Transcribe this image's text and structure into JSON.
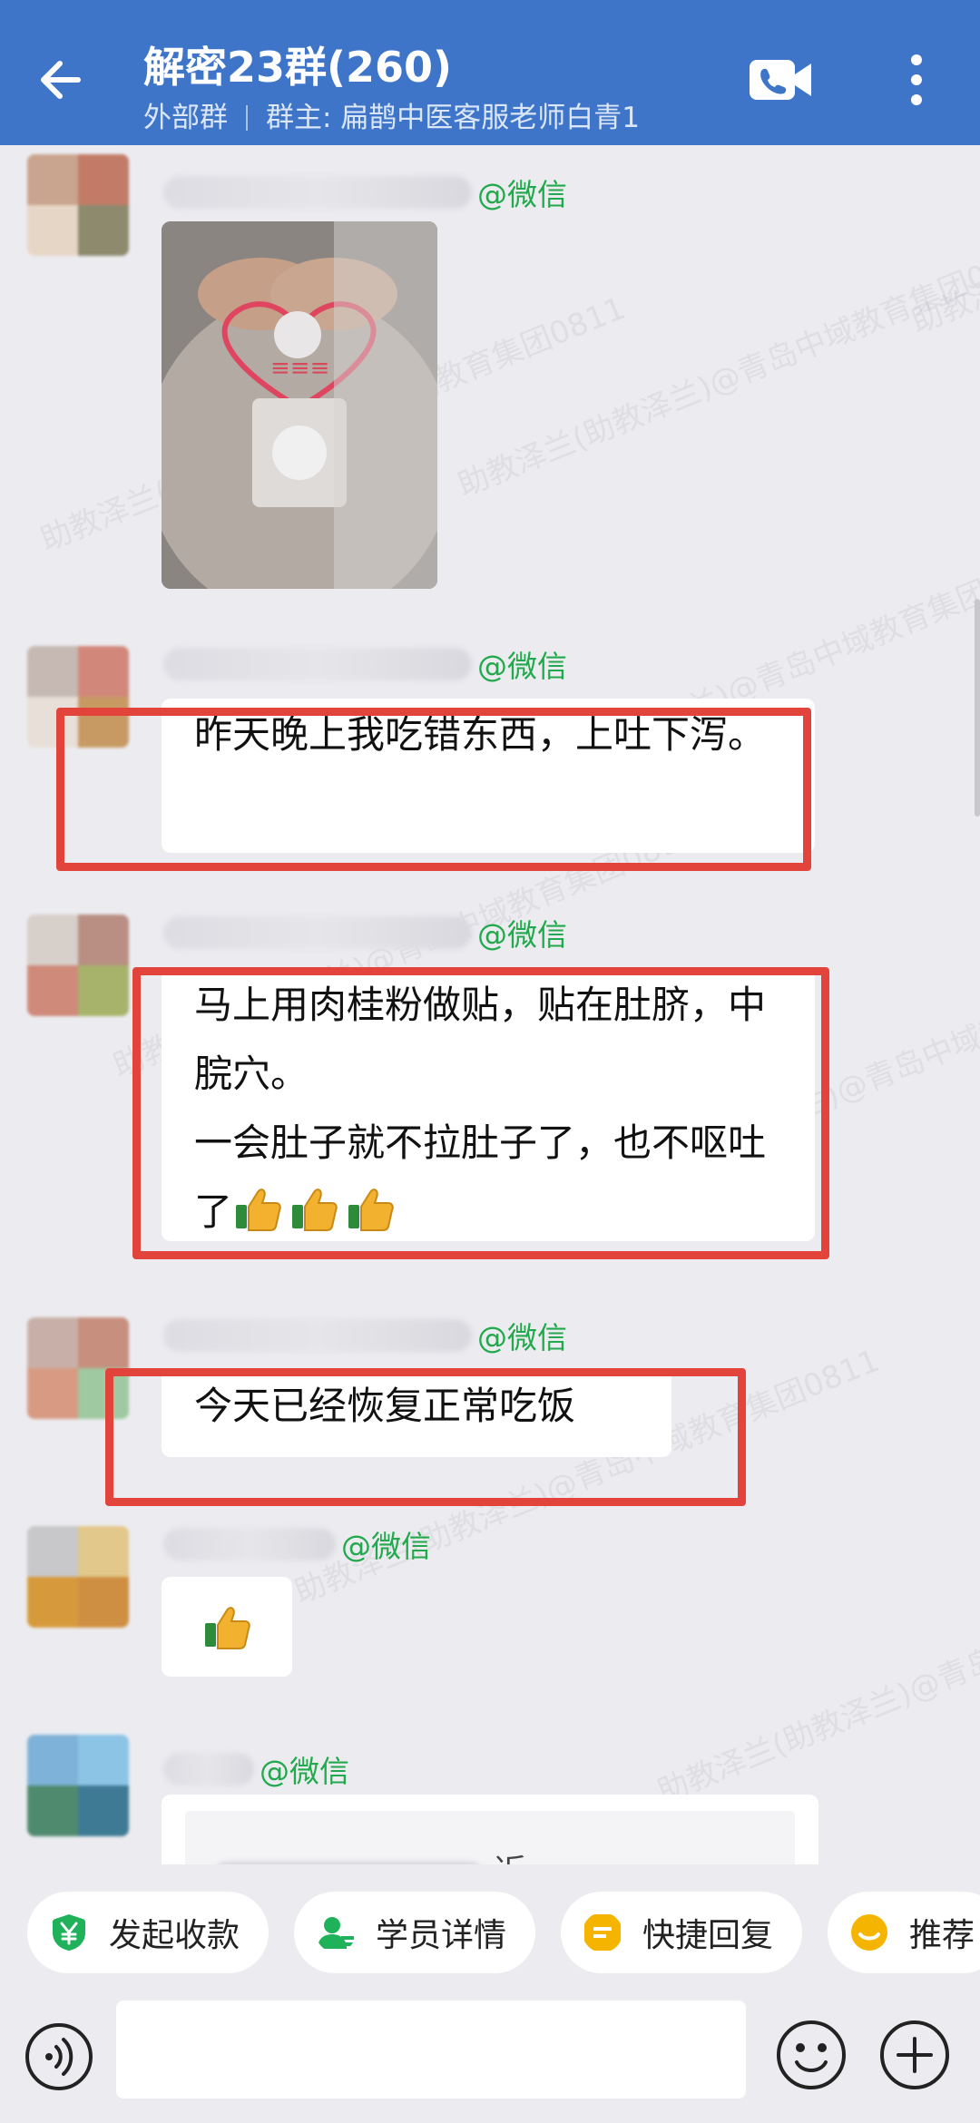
{
  "header": {
    "title": "解密23群(260)",
    "group_type": "外部群",
    "owner": "群主: 扁鹊中医客服老师白青1"
  },
  "watermark": {
    "text": "助教泽兰(助教泽兰)@青岛中域教育集团0811"
  },
  "messages": [
    {
      "tag": "@微信",
      "type": "image"
    },
    {
      "tag": "@微信",
      "text": "昨天晚上我吃错东西，上吐下泻。"
    },
    {
      "tag": "@微信",
      "text_line1": "马上用肉桂粉做贴，贴在肚脐，中脘穴。",
      "text_line2": "一会肚子就不拉肚子了，也不呕吐了"
    },
    {
      "tag": "@微信",
      "text": "今天已经恢复正常吃饭"
    },
    {
      "tag": "@微信",
      "text": ""
    },
    {
      "tag": "@微信",
      "quote_partial": "近:"
    }
  ],
  "quick_actions": [
    {
      "label": "发起收款",
      "icon": "yen-shield-icon",
      "color": "#1fb25a"
    },
    {
      "label": "学员详情",
      "icon": "user-card-icon",
      "color": "#1fb25a"
    },
    {
      "label": "快捷回复",
      "icon": "quick-reply-icon",
      "color": "#f5b400"
    },
    {
      "label": "推荐",
      "icon": "recommend-icon",
      "color": "#f5b400"
    }
  ],
  "input": {
    "placeholder": ""
  },
  "colors": {
    "header": "#3e75c9",
    "accent_green": "#23a94d",
    "highlight_red": "#e2443b"
  }
}
